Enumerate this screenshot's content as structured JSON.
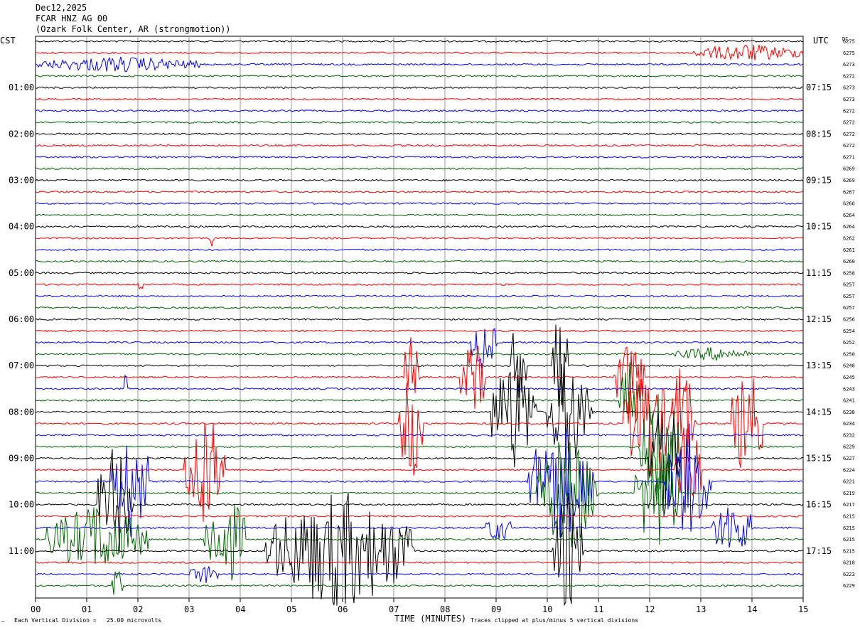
{
  "header": {
    "date": "Dec12,2025",
    "station": "FCAR HNZ AG 00",
    "location": "(Ozark Folk Center, AR (strongmotion))"
  },
  "left_axis_title": "CST",
  "right_axis_title": "UTC",
  "dc_title": "DC",
  "footer": {
    "scale_note": "Each Vertical Division =   25.00 microvolts",
    "x_axis_title": "TIME (MINUTES)",
    "clip_note": "Traces clipped at plus/minus 5 vertical divisions"
  },
  "colors": {
    "black": "#000000",
    "red": "#ff0000",
    "blue": "#0000ff",
    "green": "#006400",
    "grid": "#999999"
  },
  "chart_data": {
    "type": "line",
    "title": "FCAR HNZ AG 00",
    "xlabel": "TIME (MINUTES)",
    "xlim": [
      0,
      15
    ],
    "x_ticks": [
      "00",
      "01",
      "02",
      "03",
      "04",
      "05",
      "06",
      "07",
      "08",
      "09",
      "10",
      "11",
      "12",
      "13",
      "14",
      "15"
    ],
    "row_count": 48,
    "row_minutes": 15,
    "trace_color_cycle": [
      "black",
      "red",
      "blue",
      "green"
    ],
    "left_hour_labels": [
      "01:00",
      "02:00",
      "03:00",
      "04:00",
      "05:00",
      "06:00",
      "07:00",
      "08:00",
      "09:00",
      "10:00",
      "11:00"
    ],
    "right_hour_labels": [
      "07:15",
      "08:15",
      "09:15",
      "10:15",
      "11:15",
      "12:15",
      "13:15",
      "14:15",
      "15:15",
      "16:15",
      "17:15"
    ],
    "dc_offsets": [
      "6275",
      "6275",
      "6273",
      "6272",
      "6273",
      "6273",
      "6272",
      "6272",
      "6272",
      "6272",
      "6271",
      "6269",
      "6269",
      "6267",
      "6266",
      "6264",
      "6264",
      "6262",
      "6261",
      "6260",
      "6258",
      "6257",
      "6257",
      "6257",
      "6256",
      "6254",
      "6252",
      "6250",
      "6248",
      "6245",
      "6243",
      "6241",
      "6238",
      "6234",
      "6232",
      "6229",
      "6227",
      "6224",
      "6221",
      "6219",
      "6217",
      "6215",
      "6215",
      "6215",
      "6215",
      "6218",
      "6223",
      "6229"
    ],
    "events": [
      {
        "row": 1,
        "start": 12.8,
        "end": 15.0,
        "amp": 0.9
      },
      {
        "row": 2,
        "start": 0.0,
        "end": 3.2,
        "amp": 0.8
      },
      {
        "row": 17,
        "start": 3.4,
        "end": 3.5,
        "amp": 1.0
      },
      {
        "row": 21,
        "start": 2.0,
        "end": 2.1,
        "amp": 1.0
      },
      {
        "row": 26,
        "start": 8.5,
        "end": 9.0,
        "amp": 3.0
      },
      {
        "row": 27,
        "start": 12.5,
        "end": 14.0,
        "amp": 0.7
      },
      {
        "row": 28,
        "start": 9.3,
        "end": 9.6,
        "amp": 6.0
      },
      {
        "row": 28,
        "start": 10.1,
        "end": 10.4,
        "amp": 6.0
      },
      {
        "row": 29,
        "start": 7.2,
        "end": 7.5,
        "amp": 5.0
      },
      {
        "row": 29,
        "start": 8.3,
        "end": 8.8,
        "amp": 4.0
      },
      {
        "row": 29,
        "start": 11.3,
        "end": 11.9,
        "amp": 4.0
      },
      {
        "row": 30,
        "start": 1.7,
        "end": 1.8,
        "amp": 1.5
      },
      {
        "row": 31,
        "start": 11.4,
        "end": 11.8,
        "amp": 4.0
      },
      {
        "row": 32,
        "start": 8.9,
        "end": 9.8,
        "amp": 6.0
      },
      {
        "row": 32,
        "start": 10.0,
        "end": 10.9,
        "amp": 6.0
      },
      {
        "row": 33,
        "start": 7.1,
        "end": 7.6,
        "amp": 6.0
      },
      {
        "row": 33,
        "start": 11.5,
        "end": 12.4,
        "amp": 6.0
      },
      {
        "row": 33,
        "start": 13.6,
        "end": 14.2,
        "amp": 6.0
      },
      {
        "row": 33,
        "start": 12.3,
        "end": 12.9,
        "amp": 6.0
      },
      {
        "row": 35,
        "start": 11.8,
        "end": 12.6,
        "amp": 6.0
      },
      {
        "row": 36,
        "start": 12.0,
        "end": 12.6,
        "amp": 6.0
      },
      {
        "row": 37,
        "start": 2.9,
        "end": 3.7,
        "amp": 6.0
      },
      {
        "row": 37,
        "start": 12.5,
        "end": 13.0,
        "amp": 6.0
      },
      {
        "row": 38,
        "start": 1.5,
        "end": 2.2,
        "amp": 6.0
      },
      {
        "row": 38,
        "start": 9.6,
        "end": 10.9,
        "amp": 6.0
      },
      {
        "row": 38,
        "start": 12.3,
        "end": 13.2,
        "amp": 6.0
      },
      {
        "row": 39,
        "start": 9.8,
        "end": 11.0,
        "amp": 6.0
      },
      {
        "row": 39,
        "start": 11.7,
        "end": 12.6,
        "amp": 6.0
      },
      {
        "row": 40,
        "start": 1.2,
        "end": 1.9,
        "amp": 6.0
      },
      {
        "row": 42,
        "start": 13.2,
        "end": 14.0,
        "amp": 3.0
      },
      {
        "row": 42,
        "start": 8.8,
        "end": 9.3,
        "amp": 1.5
      },
      {
        "row": 43,
        "start": 0.2,
        "end": 2.2,
        "amp": 3.5
      },
      {
        "row": 43,
        "start": 3.3,
        "end": 4.1,
        "amp": 5.0
      },
      {
        "row": 44,
        "start": 4.5,
        "end": 7.4,
        "amp": 6.0
      },
      {
        "row": 44,
        "start": 10.1,
        "end": 10.7,
        "amp": 6.0
      },
      {
        "row": 46,
        "start": 3.0,
        "end": 3.6,
        "amp": 1.0
      },
      {
        "row": 47,
        "start": 1.5,
        "end": 1.7,
        "amp": 2.0
      }
    ]
  }
}
